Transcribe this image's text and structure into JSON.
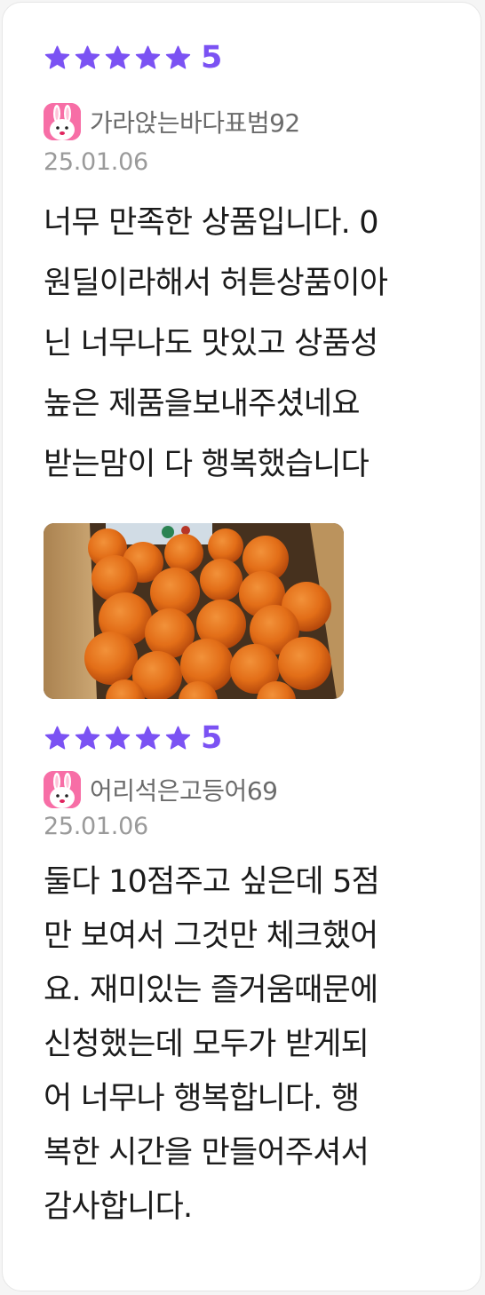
{
  "reviews": [
    {
      "rating": "5",
      "stars": 5,
      "author": "가라앉는바다표범92",
      "date": "25.01.06",
      "body_lines": [
        "너무 만족한 상품입니다. 0",
        "원딜이라해서 허튼상품이아",
        "닌 너무나도 맛있고 상품성",
        "높은 제품을보내주셨네요",
        "받는맘이 다 행복했습니다"
      ],
      "photo_icon": "tangerines-in-box-photo"
    },
    {
      "rating": "5",
      "stars": 5,
      "author": "어리석은고등어69",
      "date": "25.01.06",
      "body_lines": [
        "둘다 10점주고 싶은데 5점",
        "만 보여서 그것만 체크했어",
        "요. 재미있는 즐거움때문에",
        "신청했는데 모두가 받게되",
        "어 너무나 행복합니다. 행",
        "복한 시간을 만들어주셔서",
        "감사합니다."
      ]
    }
  ],
  "colors": {
    "accent": "#7b52f3",
    "avatar_bg": "#f76ea6",
    "secondary_text": "#6b6b6b",
    "date_text": "#9a9a9a"
  }
}
